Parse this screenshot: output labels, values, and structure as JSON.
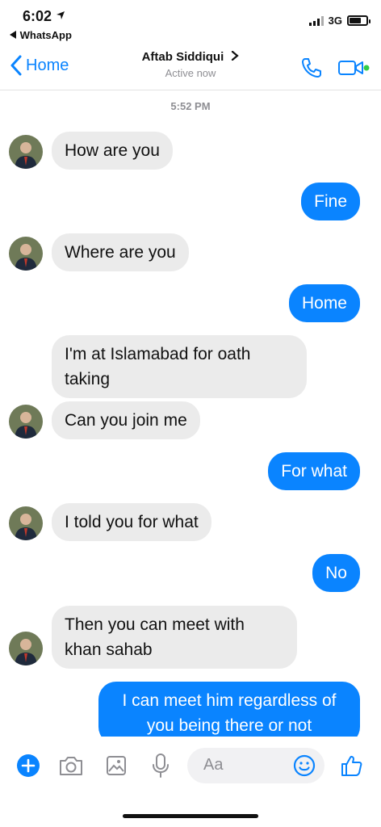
{
  "status_bar": {
    "time": "6:02",
    "back_app": "WhatsApp",
    "network": "3G"
  },
  "header": {
    "back_label": "Home",
    "contact_name": "Aftab Siddiqui",
    "contact_status": "Active now"
  },
  "chat": {
    "timestamp": "5:52 PM",
    "messages": [
      {
        "direction": "incoming",
        "text": "How are you"
      },
      {
        "direction": "outgoing",
        "text": "Fine"
      },
      {
        "direction": "incoming",
        "text": "Where are you"
      },
      {
        "direction": "outgoing",
        "text": "Home"
      },
      {
        "direction": "incoming",
        "text": "I'm at Islamabad for oath taking"
      },
      {
        "direction": "incoming",
        "text": "Can you join me"
      },
      {
        "direction": "outgoing",
        "text": "For what"
      },
      {
        "direction": "incoming",
        "text": "I told you for what"
      },
      {
        "direction": "outgoing",
        "text": "No"
      },
      {
        "direction": "incoming",
        "text": "Then you can meet with khan sahab"
      },
      {
        "direction": "outgoing",
        "text": "I can meet him regardless of you being there or not"
      }
    ]
  },
  "composer": {
    "placeholder": "Aa"
  },
  "colors": {
    "accent": "#0a84ff",
    "incoming_bubble": "#ebebeb",
    "status_dot": "#31cc46"
  },
  "icons": [
    "location-arrow-icon",
    "back-triangle-icon",
    "chevron-left-icon",
    "chevron-right-icon",
    "phone-icon",
    "video-camera-icon",
    "plus-icon",
    "camera-icon",
    "image-icon",
    "microphone-icon",
    "emoji-icon",
    "thumbs-up-icon"
  ]
}
